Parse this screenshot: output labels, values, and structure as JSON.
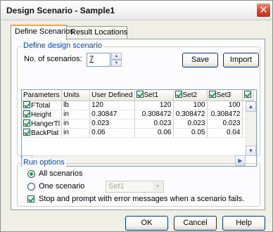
{
  "window": {
    "title": "Design  Scenario - Sample1",
    "close_glyph": "✕"
  },
  "tabs": [
    {
      "label": "Define Scenarios",
      "active": true
    },
    {
      "label": "Result Locations",
      "active": false
    }
  ],
  "define_group": {
    "legend": "Define design scenario",
    "num_label": "No. of scenarios:",
    "num_value": "7",
    "save_label": "Save",
    "import_label": "Import"
  },
  "grid": {
    "headers": [
      "Parameters",
      "Units",
      "User Defined",
      "Set1",
      "Set2",
      "Set3",
      ""
    ],
    "rows": [
      {
        "param": "FTotal",
        "units": "lb",
        "user": "120",
        "set1": "120",
        "set2": "100",
        "set3": "100"
      },
      {
        "param": "Height",
        "units": "in",
        "user": "0.30847",
        "set1": "0.308472",
        "set2": "0.308472",
        "set3": "0.308472"
      },
      {
        "param": "HangerTl",
        "units": "in",
        "user": "0.023",
        "set1": "0.023",
        "set2": "0.023",
        "set3": "0.023"
      },
      {
        "param": "BackPlat",
        "units": "in",
        "user": "0.06",
        "set1": "0.06",
        "set2": "0.05",
        "set3": "0.04"
      }
    ]
  },
  "run_group": {
    "legend": "Run options",
    "all_label": "All scenarios",
    "one_label": "One scenario",
    "one_select_value": "Set1",
    "stop_label": "Stop and prompt with error messages when a scenario fails."
  },
  "footer": {
    "ok_label": "OK",
    "cancel_label": "Cancel",
    "help_label": "Help"
  },
  "icons": {
    "spin_up": "▲",
    "spin_down": "▼",
    "scroll_up": "▲",
    "scroll_down": "▼",
    "scroll_left": "◀",
    "scroll_right": "▶",
    "dropdown": "▼"
  },
  "colors": {
    "legend_text": "#0046d5",
    "tab_highlight": "#f3a44e",
    "check_green": "#21a121",
    "close_red": "#d6452a"
  }
}
